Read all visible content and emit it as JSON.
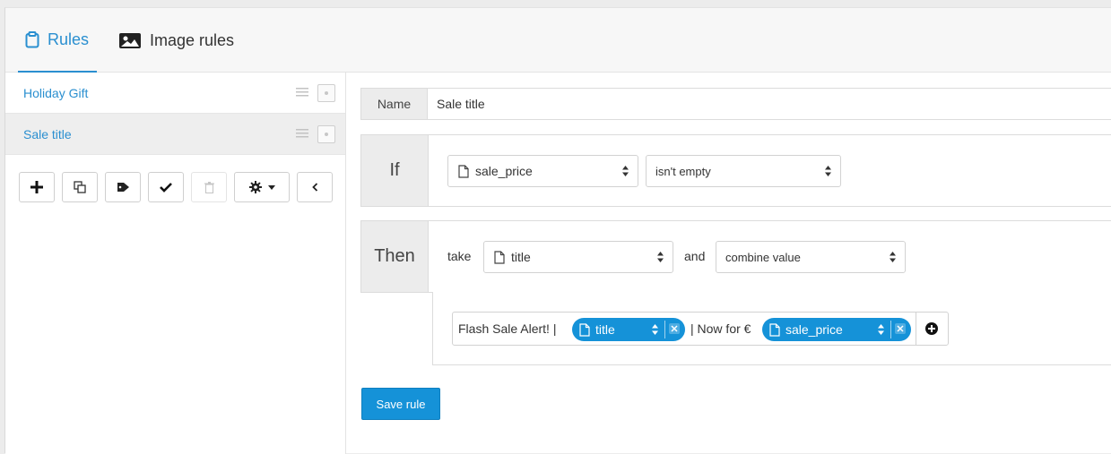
{
  "tabs": [
    {
      "label": "Rules",
      "icon": "clipboard-icon",
      "active": true
    },
    {
      "label": "Image rules",
      "icon": "image-icon",
      "active": false
    }
  ],
  "sidebar": {
    "rules": [
      {
        "label": "Holiday Gift",
        "active": false
      },
      {
        "label": "Sale title",
        "active": true
      }
    ],
    "toolbar": [
      "plus-icon",
      "copy-icon",
      "tag-icon",
      "check-icon",
      "trash-icon",
      "gear-dropdown-icon",
      "chevron-left-icon"
    ]
  },
  "editor": {
    "name_label": "Name",
    "name_value": "Sale title",
    "if_label": "If",
    "if_field": "sale_price",
    "if_condition": "isn't empty",
    "then_label": "Then",
    "take_label": "take",
    "take_field": "title",
    "and_label": "and",
    "action": "combine value",
    "combine": {
      "text_before": "Flash Sale Alert! |",
      "pill1": "title",
      "text_middle": "| Now for €",
      "pill2": "sale_price"
    },
    "save_label": "Save rule"
  },
  "colors": {
    "accent": "#1592d8",
    "link": "#2a8fd0"
  }
}
